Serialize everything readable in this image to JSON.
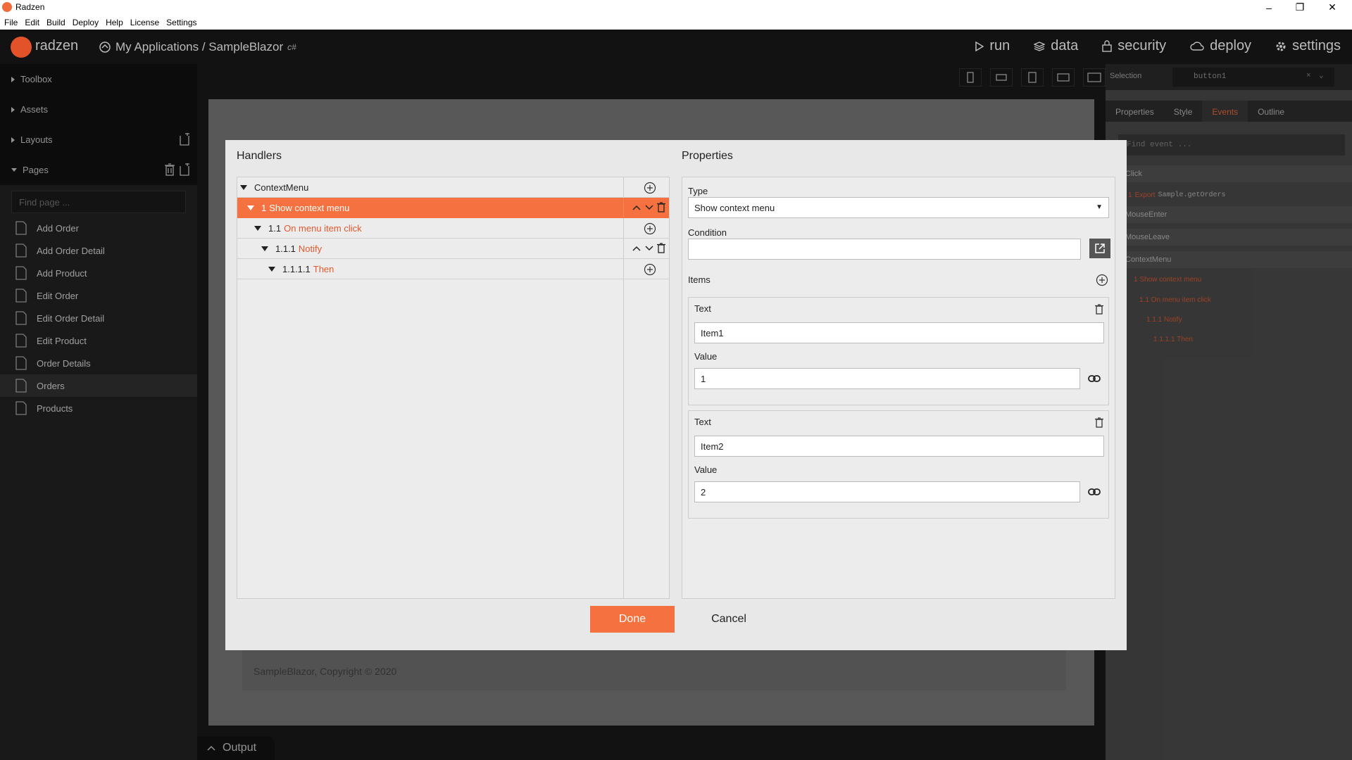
{
  "window": {
    "title": "Radzen"
  },
  "menu": [
    "File",
    "Edit",
    "Build",
    "Deploy",
    "Help",
    "License",
    "Settings"
  ],
  "header": {
    "logo_text": "radzen",
    "breadcrumb": "My Applications / SampleBlazor",
    "lang": "c#",
    "nav": {
      "run": "run",
      "data": "data",
      "security": "security",
      "deploy": "deploy",
      "settings": "settings"
    }
  },
  "sidebar": {
    "toolbox": "Toolbox",
    "assets": "Assets",
    "layouts": "Layouts",
    "pages": "Pages",
    "find_placeholder": "Find page ...",
    "page_items": [
      "Add Order",
      "Add Order Detail",
      "Add Product",
      "Edit Order",
      "Edit Order Detail",
      "Edit Product",
      "Order Details",
      "Orders",
      "Products"
    ],
    "active_page": "Orders"
  },
  "canvas": {
    "footer": "SampleBlazor, Copyright © 2020",
    "output_tab": "Output"
  },
  "right_panel": {
    "selection_label": "Selection",
    "selection_value": "button1",
    "tabs": [
      "Properties",
      "Style",
      "Events",
      "Outline"
    ],
    "active_tab": "Events",
    "find_event_placeholder": "Find event ...",
    "events": {
      "click": "Click",
      "click_sub_num": "1",
      "click_sub_action": "Export",
      "click_sub_target": "Sample.getOrders",
      "mouse_enter": "MouseEnter",
      "mouse_leave": "MouseLeave",
      "context_menu": "ContextMenu",
      "cm_1": "1 Show context menu",
      "cm_1_1": "1.1 On menu item click",
      "cm_1_1_1": "1.1.1 Notify",
      "cm_1_1_1_1": "1.1.1.1 Then"
    }
  },
  "modal": {
    "handlers_title": "Handlers",
    "properties_title": "Properties",
    "tree": {
      "root": "ContextMenu",
      "n1_num": "1",
      "n1_label": "Show context menu",
      "n2_num": "1.1",
      "n2_label": "On menu item click",
      "n3_num": "1.1.1",
      "n3_label": "Notify",
      "n4_num": "1.1.1.1",
      "n4_label": "Then"
    },
    "type_label": "Type",
    "type_value": "Show context menu",
    "condition_label": "Condition",
    "condition_value": "",
    "items_label": "Items",
    "items": [
      {
        "text_label": "Text",
        "text_value": "Item1",
        "value_label": "Value",
        "value_value": "1"
      },
      {
        "text_label": "Text",
        "text_value": "Item2",
        "value_label": "Value",
        "value_value": "2"
      }
    ],
    "done": "Done",
    "cancel": "Cancel"
  },
  "colors": {
    "accent": "#f5713f",
    "accent_text": "#e25a2c"
  }
}
